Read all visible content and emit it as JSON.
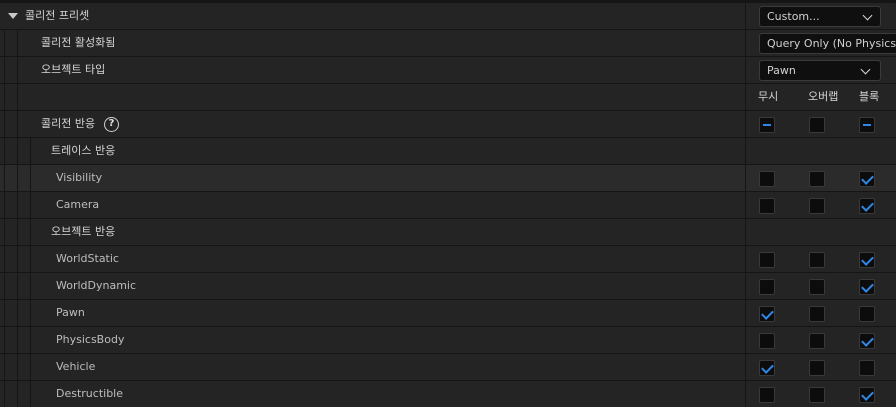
{
  "preset": {
    "label": "콜리전 프리셋",
    "value": "Custom..."
  },
  "collision_enabled": {
    "label": "콜리전 활성화됨",
    "value": "Query Only (No Physics Collision)"
  },
  "object_type": {
    "label": "오브젝트 타입",
    "value": "Pawn"
  },
  "columns": {
    "ignore": "무시",
    "overlap": "오버랩",
    "block": "블록"
  },
  "collision_response": {
    "label": "콜리전 반응",
    "help_glyph": "?",
    "states": [
      "mixed",
      "unchecked",
      "mixed"
    ]
  },
  "trace_response": {
    "label": "트레이스 반응"
  },
  "object_response": {
    "label": "오브젝트 반응"
  },
  "channels": [
    {
      "name": "Visibility",
      "response": "block"
    },
    {
      "name": "Camera",
      "response": "block"
    },
    {
      "name": "WorldStatic",
      "response": "block"
    },
    {
      "name": "WorldDynamic",
      "response": "block"
    },
    {
      "name": "Pawn",
      "response": "ignore"
    },
    {
      "name": "PhysicsBody",
      "response": "block"
    },
    {
      "name": "Vehicle",
      "response": "ignore"
    },
    {
      "name": "Destructible",
      "response": "block"
    }
  ],
  "colors": {
    "accent": "#2f88e6",
    "panel": "#242424",
    "background": "#151515"
  }
}
